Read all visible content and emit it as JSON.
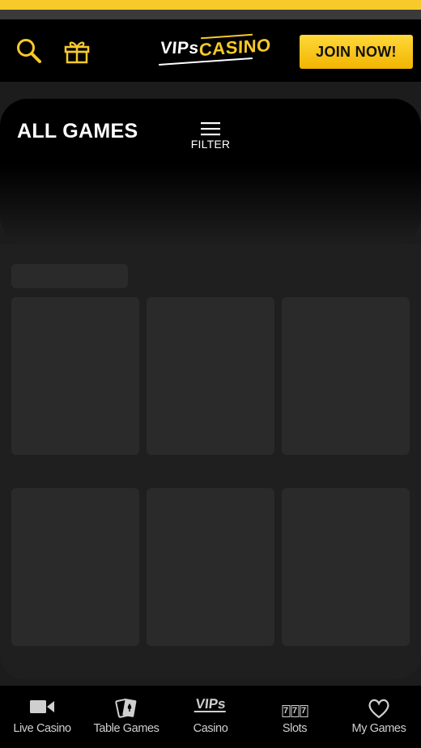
{
  "colors": {
    "accent": "#f7c92a",
    "background": "#1c1c1c",
    "header": "#000000",
    "skeleton": "#2a2a2a"
  },
  "header": {
    "logo": {
      "left": "VIPs",
      "right": "CASINO"
    },
    "join_label": "JOIN NOW!",
    "icons": [
      "search-icon",
      "gift-icon"
    ]
  },
  "hero": {
    "title": "ALL GAMES",
    "filter_label": "FILTER"
  },
  "bottom_nav": {
    "items": [
      {
        "label": "Live Casino",
        "icon": "video-camera-icon"
      },
      {
        "label": "Table Games",
        "icon": "playing-cards-icon"
      },
      {
        "label": "Casino",
        "icon": "vips-logo-icon"
      },
      {
        "label": "Slots",
        "icon": "slots-777-icon",
        "glyph": "7"
      },
      {
        "label": "My Games",
        "icon": "heart-icon"
      }
    ]
  }
}
